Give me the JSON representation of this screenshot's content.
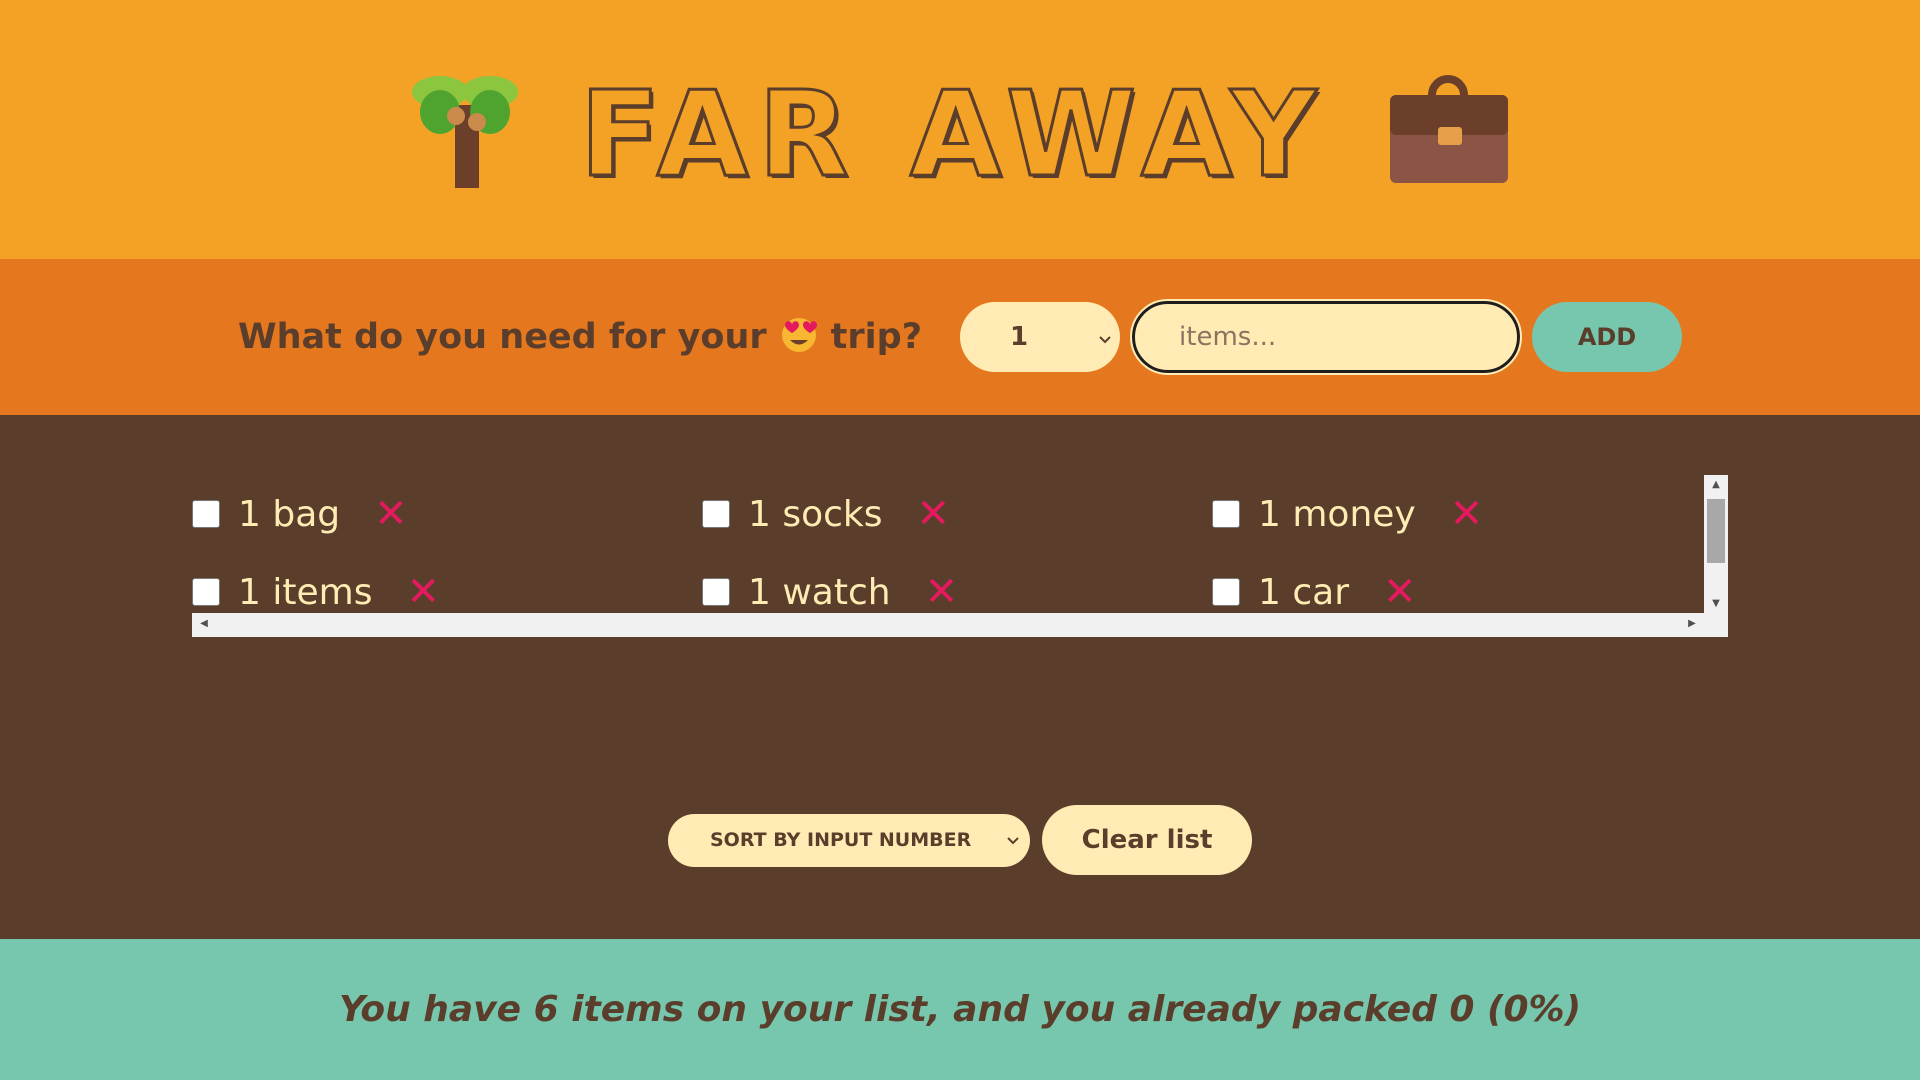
{
  "header": {
    "title": "FAR AWAY",
    "left_icon": "palm-tree-icon",
    "right_icon": "briefcase-icon"
  },
  "form": {
    "question_prefix": "What do you need for your",
    "question_emoji": "heart-eyes-emoji",
    "question_suffix": "trip?",
    "quantity_value": "1",
    "item_placeholder": "items...",
    "add_label": "ADD"
  },
  "items": [
    {
      "quantity": "1",
      "description": "bag",
      "packed": false
    },
    {
      "quantity": "1",
      "description": "socks",
      "packed": false
    },
    {
      "quantity": "1",
      "description": "money",
      "packed": false
    },
    {
      "quantity": "1",
      "description": "items",
      "packed": false
    },
    {
      "quantity": "1",
      "description": "watch",
      "packed": false
    },
    {
      "quantity": "1",
      "description": "car",
      "packed": false
    }
  ],
  "actions": {
    "sort_value": "SORT BY INPUT NUMBER",
    "clear_label": "Clear list"
  },
  "stats": {
    "text": "You have 6 items on your list, and you already packed 0 (0%)"
  },
  "colors": {
    "header_bg": "#f4a226",
    "form_bg": "#e5771e",
    "list_bg": "#5a3e2b",
    "stats_bg": "#76c7ad",
    "pill_bg": "#ffebb3",
    "delete_color": "#e5195e"
  }
}
